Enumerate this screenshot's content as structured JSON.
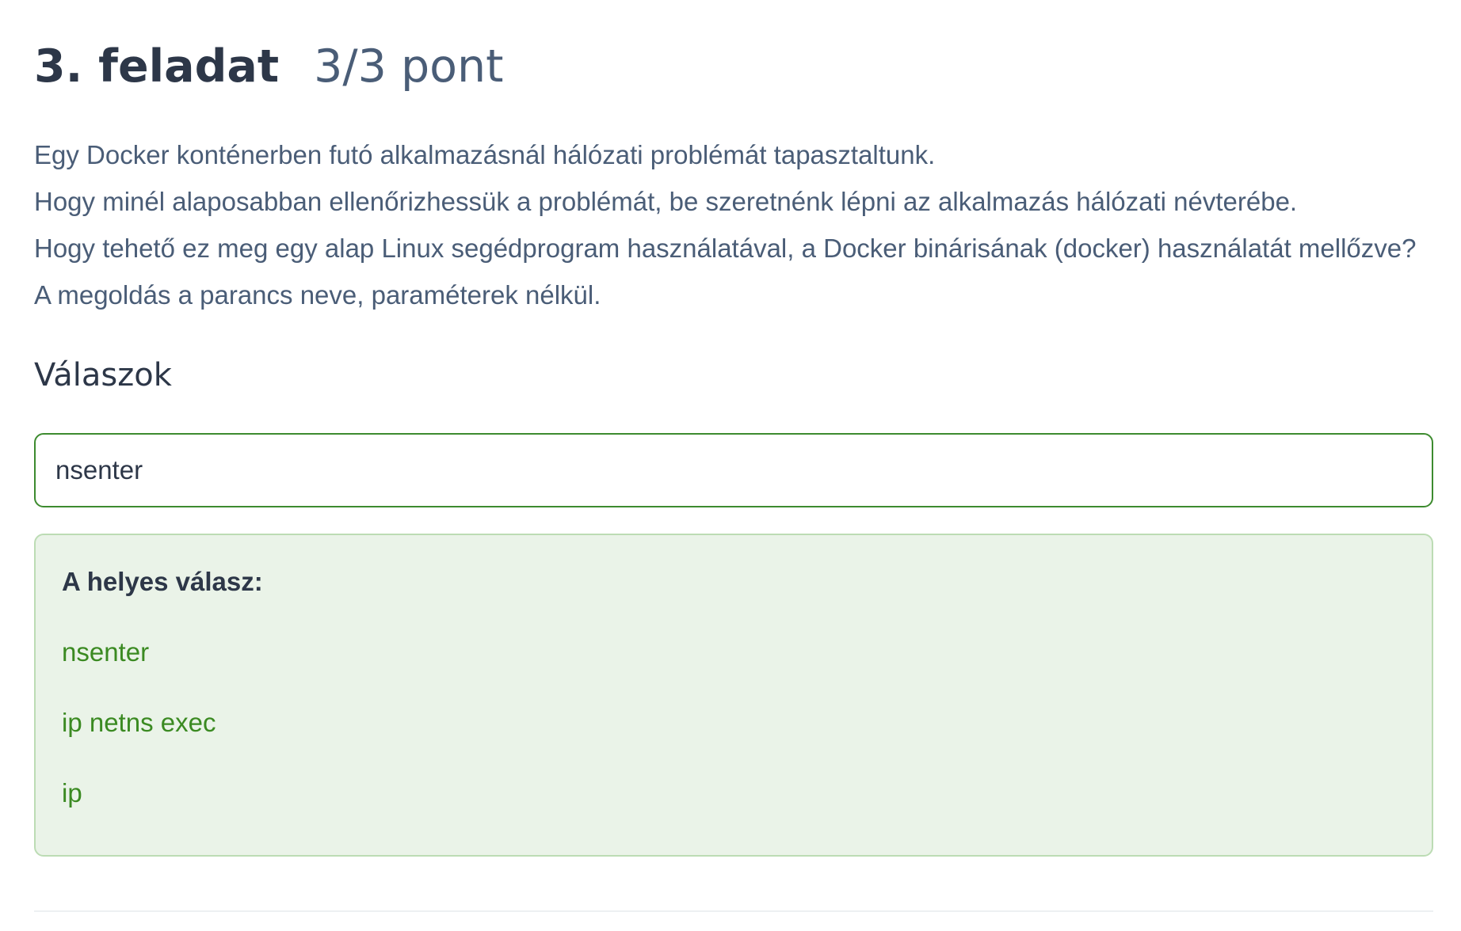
{
  "task": {
    "title": "3. feladat",
    "score": "3/3 pont"
  },
  "question": {
    "lines": [
      "Egy Docker konténerben futó alkalmazásnál hálózati problémát tapasztaltunk.",
      "Hogy minél alaposabban ellenőrizhessük a problémát, be szeretnénk lépni az alkalmazás hálózati névterébe.",
      "Hogy tehető ez meg egy alap Linux segédprogram használatával, a Docker binárisának (docker) használatát mellőzve?",
      "A megoldás a parancs neve, paraméterek nélkül."
    ]
  },
  "answers": {
    "heading": "Válaszok",
    "input_value": "nsenter"
  },
  "feedback": {
    "label": "A helyes válasz:",
    "correct_answers": [
      "nsenter",
      "ip netns exec",
      "ip"
    ]
  },
  "colors": {
    "heading": "#2d3748",
    "body_text": "#4a5d77",
    "correct_green": "#3b8a22",
    "input_border": "#3d8b2f",
    "feedback_bg": "#eaf3e8",
    "feedback_border": "#bcdcb4"
  }
}
